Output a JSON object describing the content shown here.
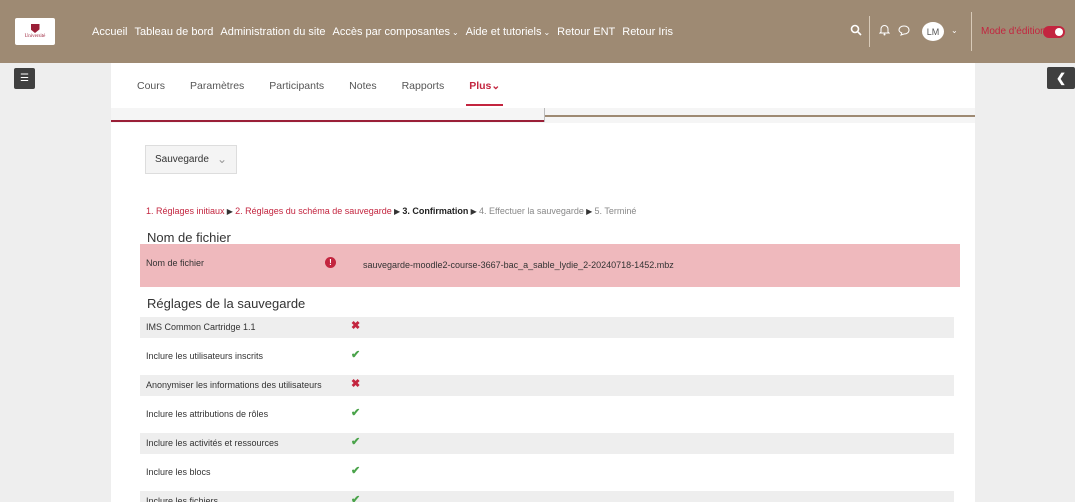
{
  "nav": {
    "logo_text": "Université",
    "items": [
      {
        "label": "Accueil",
        "caret": false
      },
      {
        "label": "Tableau de bord",
        "caret": false
      },
      {
        "label": "Administration du site",
        "caret": false
      },
      {
        "label": "Accès par composantes",
        "caret": true
      },
      {
        "label": "Aide et tutoriels",
        "caret": true
      },
      {
        "label": "Retour ENT",
        "caret": false
      },
      {
        "label": "Retour Iris",
        "caret": false
      }
    ],
    "avatar_initials": "LM",
    "mode_label": "Mode d'édition",
    "mode_on": true
  },
  "secondary_nav": {
    "tabs": [
      "Cours",
      "Paramètres",
      "Participants",
      "Notes",
      "Rapports"
    ],
    "more_label": "Plus"
  },
  "select": {
    "value": "Sauvegarde"
  },
  "steps": [
    {
      "label": "1. Réglages initiaux",
      "state": "done"
    },
    {
      "label": "2. Réglages du schéma de sauvegarde",
      "state": "done"
    },
    {
      "label": "3. Confirmation",
      "state": "current"
    },
    {
      "label": "4. Effectuer la sauvegarde",
      "state": "todo"
    },
    {
      "label": "5. Terminé",
      "state": "todo"
    }
  ],
  "filename_section": {
    "heading": "Nom de fichier",
    "label": "Nom de fichier",
    "value": "sauvegarde-moodle2-course-3667-bac_a_sable_lydie_2-20240718-1452.mbz"
  },
  "settings_section": {
    "heading": "Réglages de la sauvegarde",
    "rows": [
      {
        "label": "IMS Common Cartridge 1.1",
        "enabled": false
      },
      {
        "label": "Inclure les utilisateurs inscrits",
        "enabled": true
      },
      {
        "label": "Anonymiser les informations des utilisateurs",
        "enabled": false
      },
      {
        "label": "Inclure les attributions de rôles",
        "enabled": true
      },
      {
        "label": "Inclure les activités et ressources",
        "enabled": true
      },
      {
        "label": "Inclure les blocs",
        "enabled": true
      },
      {
        "label": "Inclure les fichiers",
        "enabled": true
      }
    ]
  },
  "colors": {
    "brand_red": "#c3253f",
    "nav_bg": "#9e8a73",
    "error_bg": "#efb9bd",
    "check_green": "#4aa34a"
  }
}
